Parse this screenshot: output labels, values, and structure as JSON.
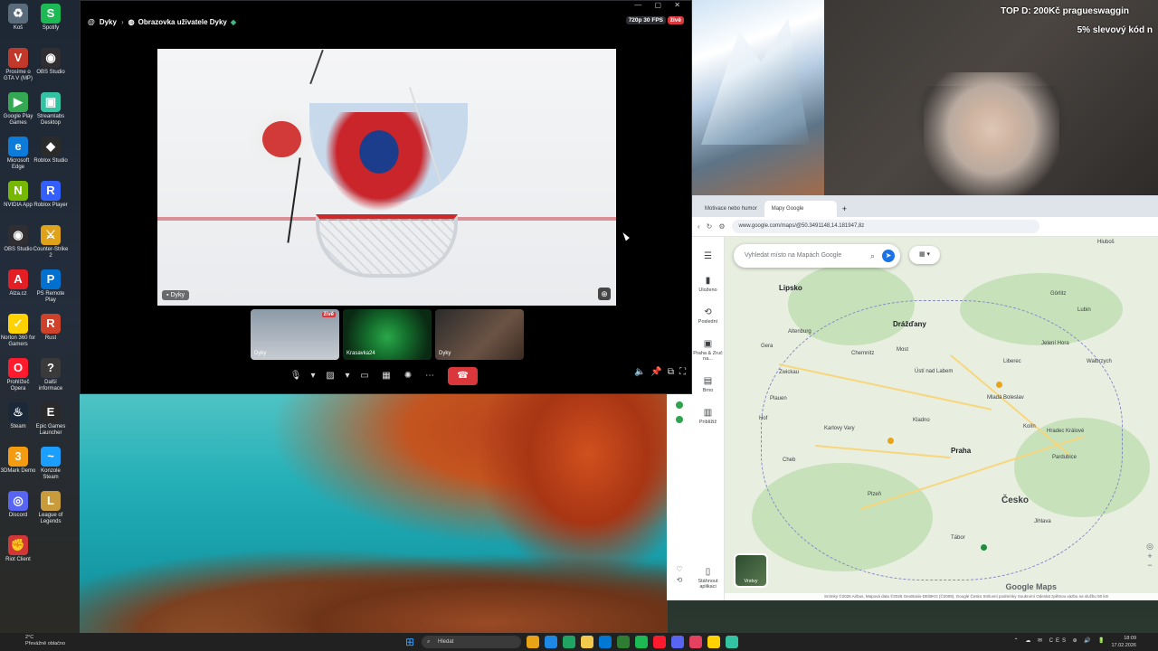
{
  "desktop": {
    "icons": [
      {
        "label": "Koš",
        "color": "#5a6b7b",
        "glyph": "♻"
      },
      {
        "label": "Spotify",
        "color": "#1db954",
        "glyph": "S"
      },
      {
        "label": "Prosíme o GTA V (MP)",
        "color": "#c0392b",
        "glyph": "V"
      },
      {
        "label": "OBS Studio",
        "color": "#302e31",
        "glyph": "◉"
      },
      {
        "label": "Google Play Games",
        "color": "#34a853",
        "glyph": "▶"
      },
      {
        "label": "Streamlabs Desktop",
        "color": "#31c3a2",
        "glyph": "▣"
      },
      {
        "label": "Microsoft Edge",
        "color": "#0c7bd9",
        "glyph": "e"
      },
      {
        "label": "Roblox Studio",
        "color": "#2b2b2b",
        "glyph": "◆"
      },
      {
        "label": "NVIDIA App",
        "color": "#76b900",
        "glyph": "N"
      },
      {
        "label": "Roblox Player",
        "color": "#335fff",
        "glyph": "R"
      },
      {
        "label": "OBS Studio",
        "color": "#302e31",
        "glyph": "◉"
      },
      {
        "label": "Counter-Strike 2",
        "color": "#e0a21a",
        "glyph": "⚔"
      },
      {
        "label": "Alza.cz",
        "color": "#e31e24",
        "glyph": "A"
      },
      {
        "label": "PS Remote Play",
        "color": "#0070d1",
        "glyph": "P"
      },
      {
        "label": "Norton 360 for Gamers",
        "color": "#ffd200",
        "glyph": "✓"
      },
      {
        "label": "Rust",
        "color": "#ce422b",
        "glyph": "R"
      },
      {
        "label": "Prohlížeč Opera",
        "color": "#ff1b2d",
        "glyph": "O"
      },
      {
        "label": "Další informace",
        "color": "#3a3a3a",
        "glyph": "?"
      },
      {
        "label": "Steam",
        "color": "#1b2838",
        "glyph": "♨"
      },
      {
        "label": "Epic Games Launcher",
        "color": "#2a2a2a",
        "glyph": "E"
      },
      {
        "label": "3DMark Demo",
        "color": "#f39c12",
        "glyph": "3"
      },
      {
        "label": "Konzole Steam",
        "color": "#1a9fff",
        "glyph": "~"
      },
      {
        "label": "Discord",
        "color": "#5865f2",
        "glyph": "◎"
      },
      {
        "label": "League of Legends",
        "color": "#c89b3c",
        "glyph": "L"
      },
      {
        "label": "Riot Client",
        "color": "#d13639",
        "glyph": "✊"
      }
    ]
  },
  "discord": {
    "at_icon": "@",
    "channel": "Dyky",
    "stream_title": "Obrazovka uživatele Dyky",
    "quality": "720p 30 FPS",
    "live_badge": "živě",
    "window_controls": "— ▢ ✕",
    "main_stream_tag": "Dyky",
    "thumbnails": [
      {
        "label": "Dyky",
        "live": "živě"
      },
      {
        "label": "Krasavka24",
        "live": ""
      },
      {
        "label": "Dyky",
        "live": ""
      }
    ],
    "controls": [
      "microphone-icon",
      "chevron-down-icon",
      "camera-off-icon",
      "chevron-down-icon",
      "screen-share-icon",
      "activities-icon",
      "soundboard-icon",
      "more-icon",
      "hangup-icon"
    ],
    "right_controls": [
      "volume-icon",
      "pin-icon",
      "popout-icon",
      "fullscreen-icon"
    ]
  },
  "overlay": {
    "top_donation": "TOP D: 200Kč pragueswaggin",
    "discount": "5% slevový kód n"
  },
  "browser": {
    "tabs": [
      {
        "label": "Motivace nebo humor"
      },
      {
        "label": "Mapy Google"
      }
    ],
    "tab_new": "+",
    "url": "www.google.com/maps/@50.3491148,14.181947,8z",
    "nav_icons": [
      "‹",
      "↻",
      "⚙"
    ]
  },
  "maps": {
    "search_placeholder": "Vyhledat místo na Mapách Google",
    "chip": "▦ ▾",
    "sidebar": [
      {
        "icon": "☰",
        "label": ""
      },
      {
        "icon": "▮",
        "label": "Uloženo"
      },
      {
        "icon": "⟲",
        "label": "Poslední"
      },
      {
        "icon": "▣",
        "label": "Praha & Zruč na..."
      },
      {
        "icon": "▤",
        "label": "Brno"
      },
      {
        "icon": "▥",
        "label": "Priblížiž"
      },
      {
        "icon": "▯",
        "label": "Stáhnout aplikaci"
      }
    ],
    "cities": [
      {
        "name": "Lipsko",
        "kind": "city"
      },
      {
        "name": "Drážďany",
        "kind": "city"
      },
      {
        "name": "Praha",
        "kind": "city"
      },
      {
        "name": "Česko",
        "kind": "country"
      },
      {
        "name": "Plzeň",
        "kind": "small"
      },
      {
        "name": "Chemnitz",
        "kind": "small"
      },
      {
        "name": "Liberec",
        "kind": "small"
      },
      {
        "name": "Ústí nad Labem",
        "kind": "small"
      },
      {
        "name": "Jelení Hora",
        "kind": "small"
      },
      {
        "name": "Hradec Králové",
        "kind": "small"
      },
      {
        "name": "Pardubice",
        "kind": "small"
      },
      {
        "name": "Karlovy Vary",
        "kind": "small"
      },
      {
        "name": "Cheb",
        "kind": "small"
      },
      {
        "name": "Altenburg",
        "kind": "small"
      },
      {
        "name": "Zwickau",
        "kind": "small"
      },
      {
        "name": "Hof",
        "kind": "small"
      },
      {
        "name": "Gera",
        "kind": "small"
      },
      {
        "name": "Most",
        "kind": "small"
      },
      {
        "name": "Mladá Boleslav",
        "kind": "small"
      },
      {
        "name": "Kolín",
        "kind": "small"
      },
      {
        "name": "Jihlava",
        "kind": "small"
      },
      {
        "name": "Tábor",
        "kind": "small"
      },
      {
        "name": "Lubin",
        "kind": "small"
      },
      {
        "name": "Hluboš",
        "kind": "small"
      },
      {
        "name": "Walbrzych",
        "kind": "small"
      },
      {
        "name": "Kladno",
        "kind": "small"
      },
      {
        "name": "Plauen",
        "kind": "small"
      },
      {
        "name": "Görlitz",
        "kind": "small"
      }
    ],
    "layers_label": "Vrstvy",
    "logo": "Google Maps",
    "footer": "Snímky ©2026 Airbus, Mapová data ©2026 GeoBasis-DE/BKG (©2009), Google  Česko  Smluvní podmínky  Soukromí  Odeslat zpětnou vazbu na službu  50 km"
  },
  "taskbar": {
    "weather_temp": "2°C",
    "weather_text": "Převážně oblačno",
    "search_placeholder": "Hledat",
    "apps": [
      "#e8a317",
      "#1e88e5",
      "#1fa463",
      "#f2c94c",
      "#0078d4",
      "#2e7d32",
      "#1db954",
      "#ff1b2d",
      "#5865f2",
      "#e4405f",
      "#ffd200",
      "#31c3a2"
    ],
    "tray_icons": "⌃ ☁ ✉ CES ⊕ 🔊 🔋",
    "time": "18:09",
    "date": "17.02.2026"
  }
}
